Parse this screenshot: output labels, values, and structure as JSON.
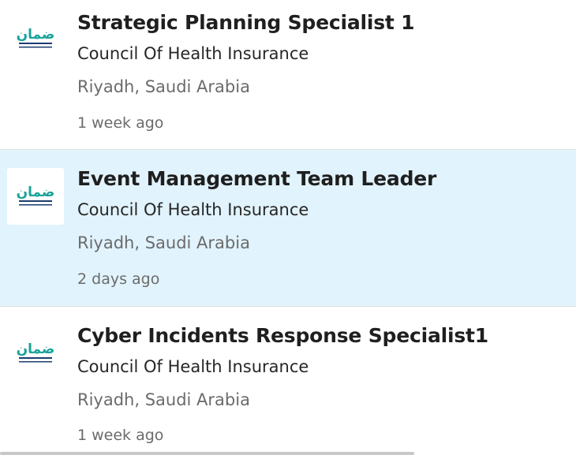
{
  "jobs": [
    {
      "title": "Strategic Planning Specialist 1",
      "company": "Council Of Health Insurance",
      "location": "Riyadh, Saudi Arabia",
      "posted": "1 week ago",
      "selected": false,
      "logo_icon": "council-of-health-insurance-logo"
    },
    {
      "title": "Event Management Team Leader",
      "company": "Council Of Health Insurance",
      "location": "Riyadh, Saudi Arabia",
      "posted": "2 days ago",
      "selected": true,
      "logo_icon": "council-of-health-insurance-logo"
    },
    {
      "title": "Cyber Incidents Response Specialist1",
      "company": "Council Of Health Insurance",
      "location": "Riyadh, Saudi Arabia",
      "posted": "1 week ago",
      "selected": false,
      "logo_icon": "council-of-health-insurance-logo"
    }
  ],
  "colors": {
    "selected_bg": "#e1f3fc",
    "logo_teal": "#1aa39a",
    "logo_navy": "#1d3d6e"
  }
}
